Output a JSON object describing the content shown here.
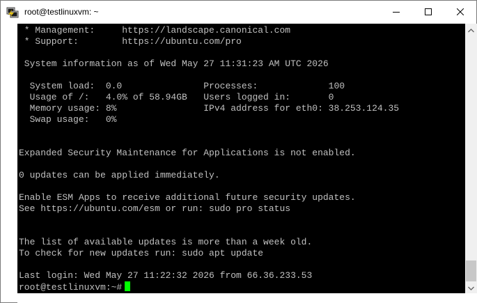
{
  "window": {
    "title": "root@testlinuxvm: ~"
  },
  "icons": {
    "app": "putty-icon",
    "minimize": "minimize-icon",
    "maximize": "maximize-icon",
    "close": "close-icon",
    "scroll_up": "chevron-up-icon",
    "scroll_down": "chevron-down-icon"
  },
  "colors": {
    "terminal_bg": "#000000",
    "terminal_text": "#c0c0c0",
    "cursor": "#00ff00"
  },
  "terminal": {
    "lines": [
      " * Management:     https://landscape.canonical.com",
      " * Support:        https://ubuntu.com/pro",
      "",
      " System information as of Wed May 27 11:31:23 AM UTC 2026",
      "",
      "  System load:  0.0               Processes:             100",
      "  Usage of /:   4.0% of 58.94GB   Users logged in:       0",
      "  Memory usage: 8%                IPv4 address for eth0: 38.253.124.35",
      "  Swap usage:   0%",
      "",
      "",
      "Expanded Security Maintenance for Applications is not enabled.",
      "",
      "0 updates can be applied immediately.",
      "",
      "Enable ESM Apps to receive additional future security updates.",
      "See https://ubuntu.com/esm or run: sudo pro status",
      "",
      "",
      "The list of available updates is more than a week old.",
      "To check for new updates run: sudo apt update",
      "",
      "Last login: Wed May 27 11:22:32 2026 from 66.36.233.53"
    ],
    "prompt": "root@testlinuxvm:~#"
  }
}
